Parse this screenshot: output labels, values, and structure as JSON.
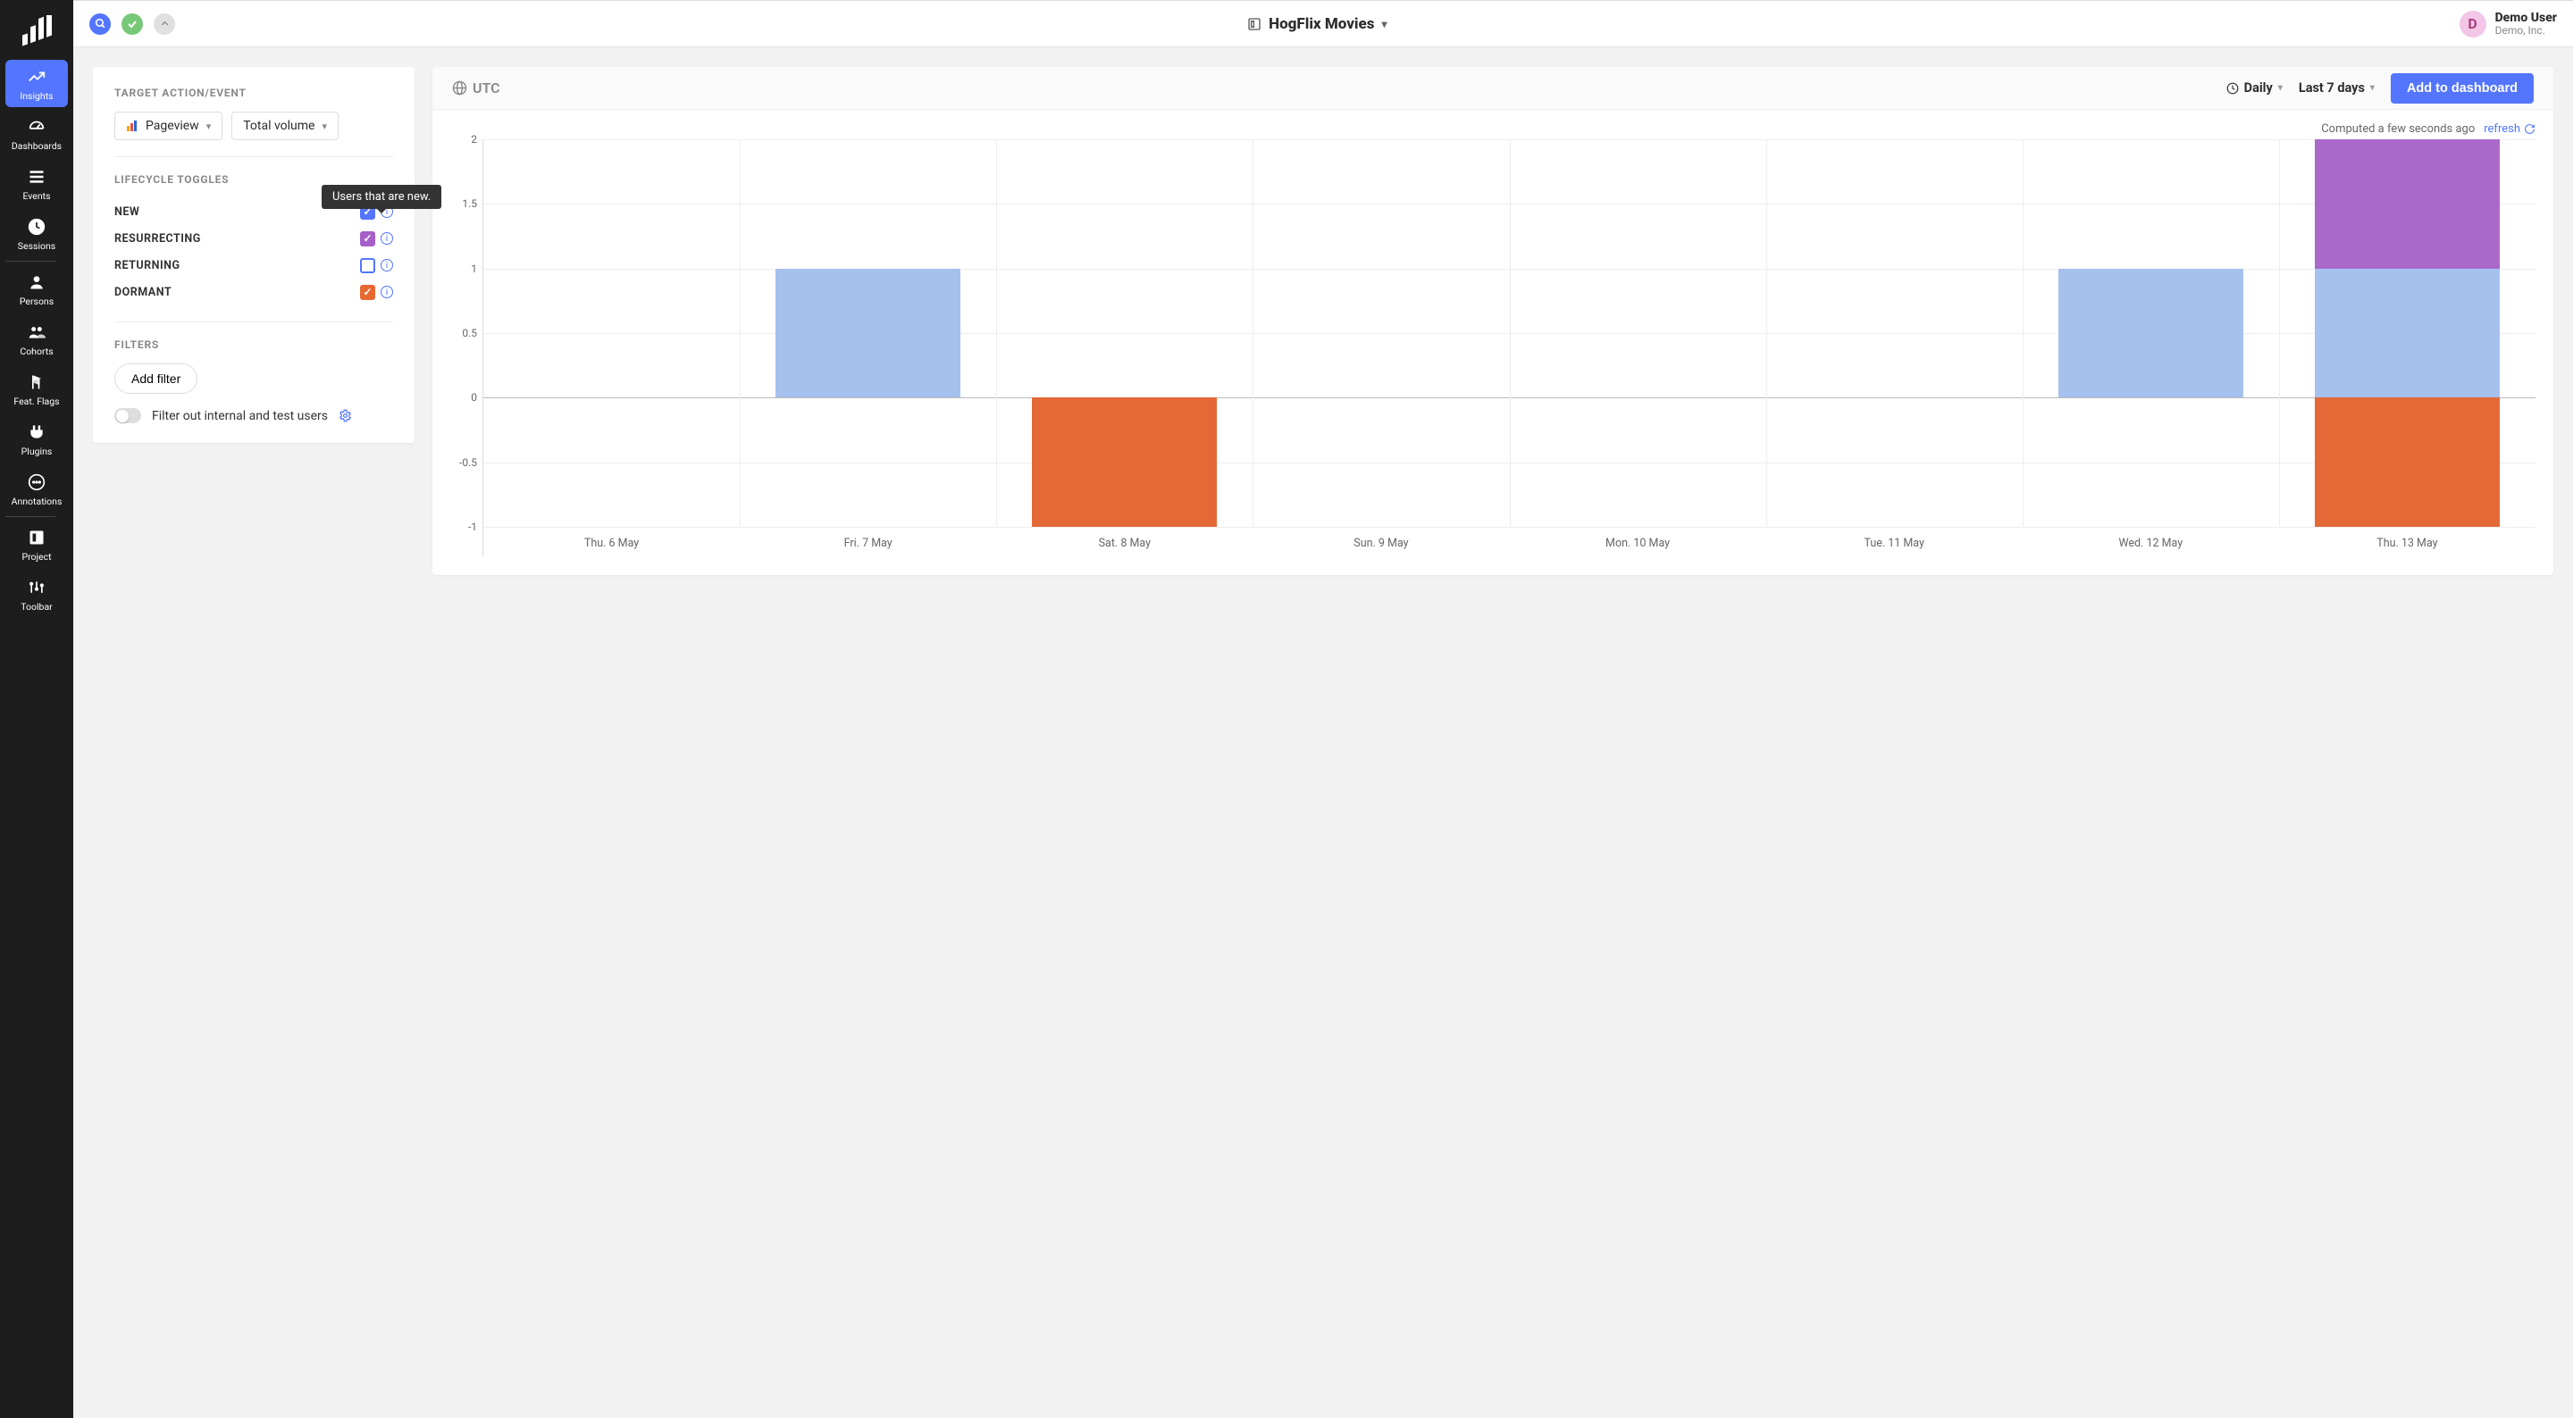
{
  "project": {
    "name": "HogFlix Movies"
  },
  "user": {
    "initial": "D",
    "name": "Demo User",
    "org": "Demo, Inc."
  },
  "nav": {
    "items": [
      {
        "id": "insights",
        "label": "Insights",
        "active": true
      },
      {
        "id": "dashboards",
        "label": "Dashboards",
        "active": false
      },
      {
        "id": "events",
        "label": "Events",
        "active": false
      },
      {
        "id": "sessions",
        "label": "Sessions",
        "active": false
      },
      {
        "id": "persons",
        "label": "Persons",
        "active": false
      },
      {
        "id": "cohorts",
        "label": "Cohorts",
        "active": false
      },
      {
        "id": "featflags",
        "label": "Feat. Flags",
        "active": false
      },
      {
        "id": "plugins",
        "label": "Plugins",
        "active": false
      },
      {
        "id": "annotations",
        "label": "Annotations",
        "active": false
      },
      {
        "id": "project",
        "label": "Project",
        "active": false
      },
      {
        "id": "toolbar",
        "label": "Toolbar",
        "active": false
      }
    ]
  },
  "config": {
    "section_target": "TARGET ACTION/EVENT",
    "event_select": "Pageview",
    "volume_select": "Total volume",
    "section_lifecycle": "LIFECYCLE TOGGLES",
    "lifecycle": [
      {
        "name": "NEW",
        "checked": true,
        "color": "#5375ff"
      },
      {
        "name": "RESURRECTING",
        "checked": true,
        "color": "#a65fc9"
      },
      {
        "name": "RETURNING",
        "checked": false,
        "color": "#5375ff"
      },
      {
        "name": "DORMANT",
        "checked": true,
        "color": "#e86832"
      }
    ],
    "section_filters": "FILTERS",
    "add_filter": "Add filter",
    "internal_toggle": "Filter out internal and test users"
  },
  "tooltip": "Users that are new.",
  "chart_header": {
    "tz": "UTC",
    "interval": "Daily",
    "range": "Last 7 days",
    "add_btn": "Add to dashboard"
  },
  "chart_meta": {
    "computed": "Computed a few seconds ago",
    "refresh": "refresh"
  },
  "chart_data": {
    "type": "bar",
    "title": "",
    "xlabel": "",
    "ylabel": "",
    "ylim": [
      -1,
      2
    ],
    "yticks": [
      2,
      1.5,
      1,
      0.5,
      0,
      -0.5,
      -1
    ],
    "categories": [
      "Thu. 6 May",
      "Fri. 7 May",
      "Sat. 8 May",
      "Sun. 9 May",
      "Mon. 10 May",
      "Tue. 11 May",
      "Wed. 12 May",
      "Thu. 13 May"
    ],
    "series": [
      {
        "name": "New",
        "color": "#a7c1ee",
        "values": [
          0,
          1,
          0,
          0,
          0,
          0,
          1,
          1
        ]
      },
      {
        "name": "Resurrecting",
        "color": "#aa68c9",
        "values": [
          0,
          0,
          0,
          0,
          0,
          0,
          0,
          1
        ]
      },
      {
        "name": "Dormant",
        "color": "#e36a36",
        "values": [
          0,
          0,
          -1,
          0,
          0,
          0,
          0,
          -1
        ]
      }
    ]
  }
}
